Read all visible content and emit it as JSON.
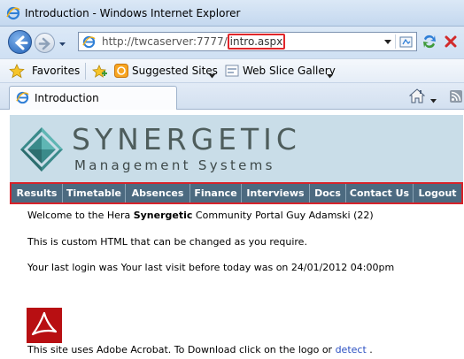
{
  "window": {
    "title": "Introduction - Windows Internet Explorer"
  },
  "address_bar": {
    "url_prefix": "http://twcaserver:7777/",
    "url_highlight": "intro.aspx"
  },
  "favorites_bar": {
    "favorites_label": "Favorites",
    "suggested_sites_label": "Suggested Sites",
    "web_slice_label": "Web Slice Gallery"
  },
  "tab": {
    "label": "Introduction"
  },
  "site": {
    "logo_name": "SYNERGETIC",
    "logo_sub": "Management Systems",
    "menu": [
      {
        "label": "Results"
      },
      {
        "label": "Timetable"
      },
      {
        "label": "Absences"
      },
      {
        "label": "Finance"
      },
      {
        "label": "Interviews"
      },
      {
        "label": "Docs"
      },
      {
        "label": "Contact Us"
      },
      {
        "label": "Logout"
      }
    ]
  },
  "content": {
    "welcome_prefix": "Welcome to the Hera ",
    "welcome_brand": "Synergetic",
    "welcome_suffix": " Community Portal Guy Adamski (22)",
    "custom_html": "This is custom HTML that can be changed as you require.",
    "last_login": "Your last login was Your last visit before today was on 24/01/2012 04:00pm",
    "acrobat_prefix": "This site uses Adobe Acrobat. To Download click on the logo or ",
    "acrobat_link": "detect",
    "acrobat_suffix": " ."
  },
  "colors": {
    "menu_bg": "#4c6a80",
    "highlight_red": "#d8232a",
    "banner_bg": "#c9dde8",
    "link": "#2a4fc2"
  }
}
